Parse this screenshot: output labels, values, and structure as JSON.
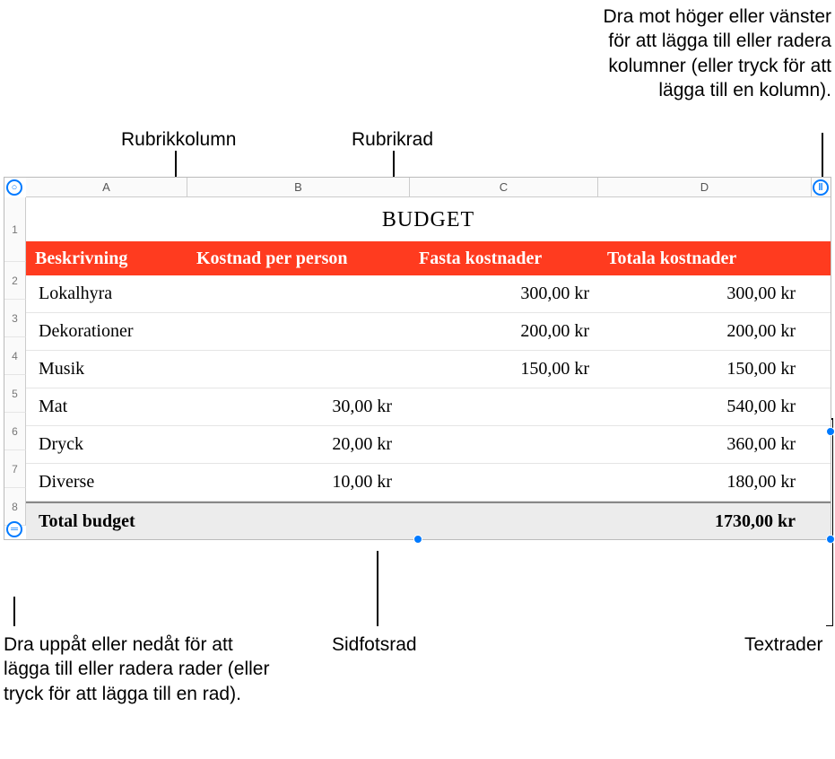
{
  "callouts": {
    "rubrikkolumn": "Rubrikkolumn",
    "rubrikrad": "Rubrikrad",
    "col_drag": "Dra mot höger eller vänster för att lägga till eller radera kolumner (eller tryck för att lägga till en kolumn).",
    "row_drag": "Dra uppåt eller nedåt för att lägga till eller radera rader (eller tryck för att lägga till en rad).",
    "sidfotsrad": "Sidfotsrad",
    "textrader": "Textrader"
  },
  "table": {
    "title": "BUDGET",
    "columns": [
      "A",
      "B",
      "C",
      "D"
    ],
    "row_numbers": [
      "1",
      "2",
      "3",
      "4",
      "5",
      "6",
      "7",
      "8"
    ],
    "headers": {
      "c1": "Beskrivning",
      "c2": "Kostnad per person",
      "c3": "Fasta kostnader",
      "c4": "Totala kostnader"
    },
    "rows": [
      {
        "c1": "Lokalhyra",
        "c2": "",
        "c3": "300,00 kr",
        "c4": "300,00 kr"
      },
      {
        "c1": "Dekorationer",
        "c2": "",
        "c3": "200,00 kr",
        "c4": "200,00 kr"
      },
      {
        "c1": "Musik",
        "c2": "",
        "c3": "150,00 kr",
        "c4": "150,00 kr"
      },
      {
        "c1": "Mat",
        "c2": "30,00 kr",
        "c3": "",
        "c4": "540,00 kr"
      },
      {
        "c1": "Dryck",
        "c2": "20,00 kr",
        "c3": "",
        "c4": "360,00 kr"
      },
      {
        "c1": "Diverse",
        "c2": "10,00 kr",
        "c3": "",
        "c4": "180,00 kr"
      }
    ],
    "footer": {
      "c1": "Total budget",
      "c4": "1730,00 kr"
    }
  },
  "chart_data": {
    "type": "table",
    "title": "BUDGET",
    "columns": [
      "Beskrivning",
      "Kostnad per person",
      "Fasta kostnader",
      "Totala kostnader"
    ],
    "rows": [
      [
        "Lokalhyra",
        null,
        300.0,
        300.0
      ],
      [
        "Dekorationer",
        null,
        200.0,
        200.0
      ],
      [
        "Musik",
        null,
        150.0,
        150.0
      ],
      [
        "Mat",
        30.0,
        null,
        540.0
      ],
      [
        "Dryck",
        20.0,
        null,
        360.0
      ],
      [
        "Diverse",
        10.0,
        null,
        180.0
      ]
    ],
    "footer": [
      "Total budget",
      null,
      null,
      1730.0
    ],
    "currency": "kr"
  }
}
